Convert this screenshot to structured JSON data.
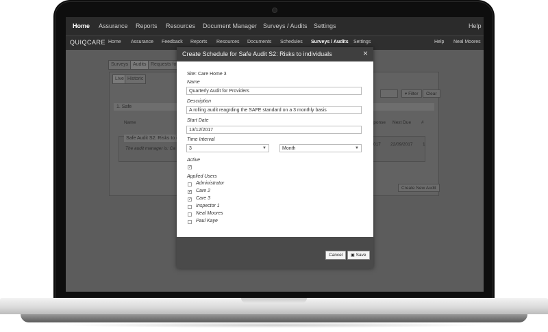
{
  "outer_nav": {
    "items": [
      "Home",
      "Assurance",
      "Reports",
      "Resources",
      "Document Manager",
      "Surveys / Audits",
      "Settings"
    ],
    "help": "Help"
  },
  "inner_nav": {
    "brand": "QUIQCARE",
    "items": [
      "Home",
      "Assurance",
      "Feedback",
      "Reports",
      "Resources",
      "Documents",
      "Schedules",
      "Surveys / Audits",
      "Settings"
    ],
    "help": "Help",
    "user": "Neal Moores"
  },
  "background": {
    "tabs": [
      "Surveys",
      "Audits",
      "Requests for"
    ],
    "subtabs": [
      "Live",
      "Historic"
    ],
    "section": "1. Safe",
    "col_name": "Name",
    "col_response": "sponse",
    "col_next_due": "Next Due",
    "col_hash": "#",
    "row_title": "Safe Audit S2: Risks to i",
    "row_sub": "The audit manager is: Ca",
    "row_date1": "017",
    "row_next_due": "22/09/2017",
    "row_count": "1",
    "filter_label": "Filter",
    "clear_label": "Clear",
    "create_label": "Create New Audit"
  },
  "modal": {
    "title": "Create Schedule for Safe Audit S2: Risks to individuals",
    "site": "Site: Care Home 3",
    "name_label": "Name",
    "name_value": "Quarterly Audit for Providers",
    "description_label": "Description",
    "description_value": "A rolling audit reagrding the SAFE standard on a 3 monthly basis",
    "start_date_label": "Start Date",
    "start_date_value": "13/12/2017",
    "interval_label": "Time Interval",
    "interval_value": "3",
    "interval_unit": "Month",
    "active_label": "Active",
    "active_checked": "✓",
    "users_label": "Applied Users",
    "users": [
      {
        "name": "Administrator",
        "mark": ""
      },
      {
        "name": "Care 2",
        "mark": "✓"
      },
      {
        "name": "Care 3",
        "mark": "✓"
      },
      {
        "name": "Inspector 1",
        "mark": ""
      },
      {
        "name": "Neal Moores",
        "mark": ""
      },
      {
        "name": "Paul Kaye",
        "mark": ""
      }
    ],
    "cancel_label": "Cancel",
    "save_label": "Save"
  }
}
